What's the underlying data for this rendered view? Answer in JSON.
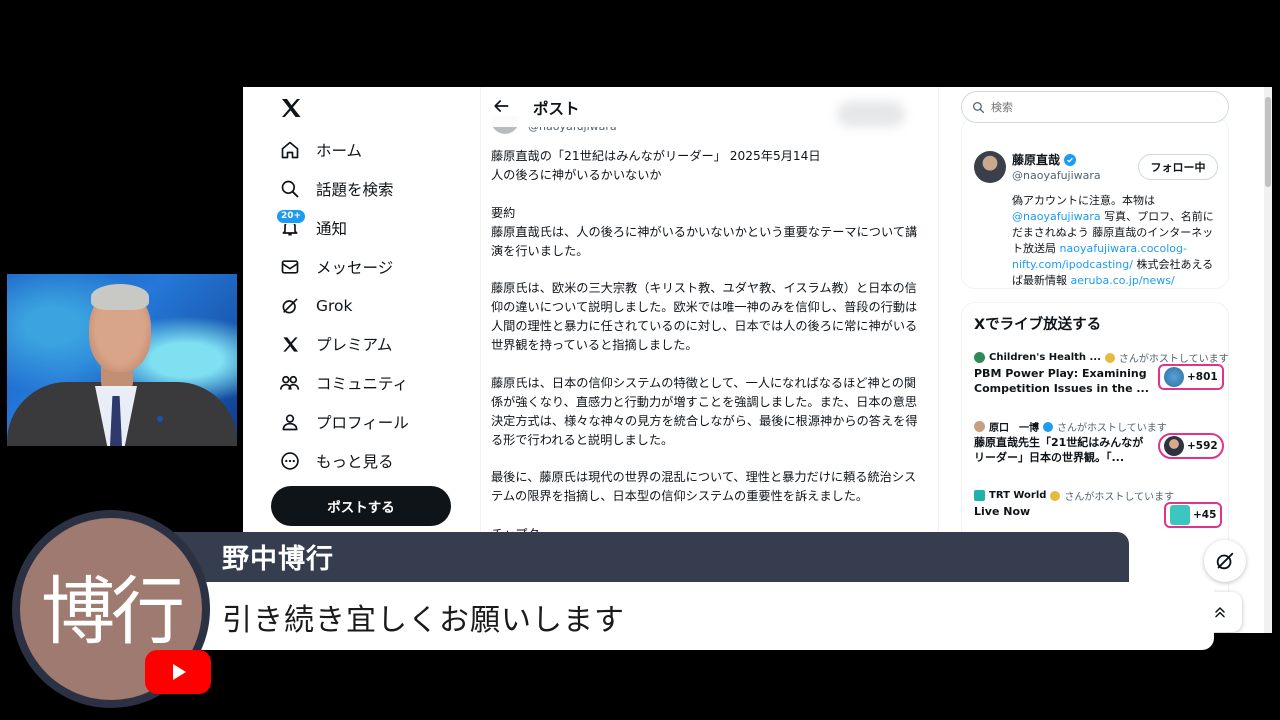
{
  "sidebar": {
    "items": [
      {
        "label": "ホーム",
        "icon": "home-icon"
      },
      {
        "label": "話題を検索",
        "icon": "search-icon"
      },
      {
        "label": "通知",
        "icon": "bell-icon",
        "badge": "20+"
      },
      {
        "label": "メッセージ",
        "icon": "mail-icon"
      },
      {
        "label": "Grok",
        "icon": "grok-icon"
      },
      {
        "label": "プレミアム",
        "icon": "x-premium-icon"
      },
      {
        "label": "コミュニティ",
        "icon": "community-icon"
      },
      {
        "label": "プロフィール",
        "icon": "profile-icon"
      },
      {
        "label": "もっと見る",
        "icon": "more-icon"
      }
    ],
    "post_button": "ポストする"
  },
  "main": {
    "title": "ポスト",
    "handle": "@naoyafujiwara",
    "post_paragraphs": [
      "藤原直哉の「21世紀はみんながリーダー」 2025年5月14日\n人の後ろに神がいるかいないか",
      "要約\n藤原直哉氏は、人の後ろに神がいるかいないかという重要なテーマについて講演を行いました。",
      "藤原氏は、欧米の三大宗教（キリスト教、ユダヤ教、イスラム教）と日本の信仰の違いについて説明しました。欧米では唯一神のみを信仰し、普段の行動は人間の理性と暴力に任されているのに対し、日本では人の後ろに常に神がいる世界観を持っていると指摘しました。",
      "藤原氏は、日本の信仰システムの特徴として、一人になればなるほど神との関係が強くなり、直感力と行動力が増すことを強調しました。また、日本の意思決定方式は、様々な神々の見方を統合しながら、最後に根源神からの答えを得る形で行われると説明しました。",
      "最後に、藤原氏は現代の世界の混乱について、理性と暴力だけに頼る統治システムの限界を指摘し、日本型の信仰システムの重要性を訴えました。"
    ],
    "post_cutoff": "チャプター"
  },
  "right": {
    "search_placeholder": "検索",
    "profile": {
      "name": "藤原直哉",
      "handle": "@naoyafujiwara",
      "follow_label": "フォロー中",
      "bio_1": "偽アカウントに注意。本物は",
      "bio_link_1": "@naoyafujiwara",
      "bio_2": " 写真、プロフ、名前にだまされぬよう 藤原直哉のインターネット放送局 ",
      "bio_link_2": "naoyafujiwara.cocolog-nifty.com/ipodcasting/",
      "bio_3": " 株式会社あえるば最新情報 ",
      "bio_link_3": "aeruba.co.jp/news/"
    },
    "live": {
      "title": "Xでライブ放送する",
      "rows": [
        {
          "host": "Children's Health ...",
          "host_suffix": "さんがホストしています",
          "title": "PBM Power Play: Examining Competition Issues in the ...",
          "count": "+801"
        },
        {
          "host": "原口　一博",
          "host_suffix": "さんがホストしています",
          "title": "藤原直哉先生「21世紀はみんながリーダー」日本の世界観。「...",
          "count": "+592"
        },
        {
          "host": "TRT World",
          "host_suffix": "さんがホストしています",
          "title": "Live Now",
          "count": "+45"
        }
      ]
    }
  },
  "overlay": {
    "speaker_name": "野中博行",
    "message": "引き続き宜しくお願いします",
    "avatar_text": "博行"
  },
  "colors": {
    "x_blue": "#1d9bf0",
    "name_bar": "#353d4e",
    "avatar_bg": "#9e7a70",
    "youtube_red": "#ff0000",
    "live_pill_border": "#e0338a"
  }
}
